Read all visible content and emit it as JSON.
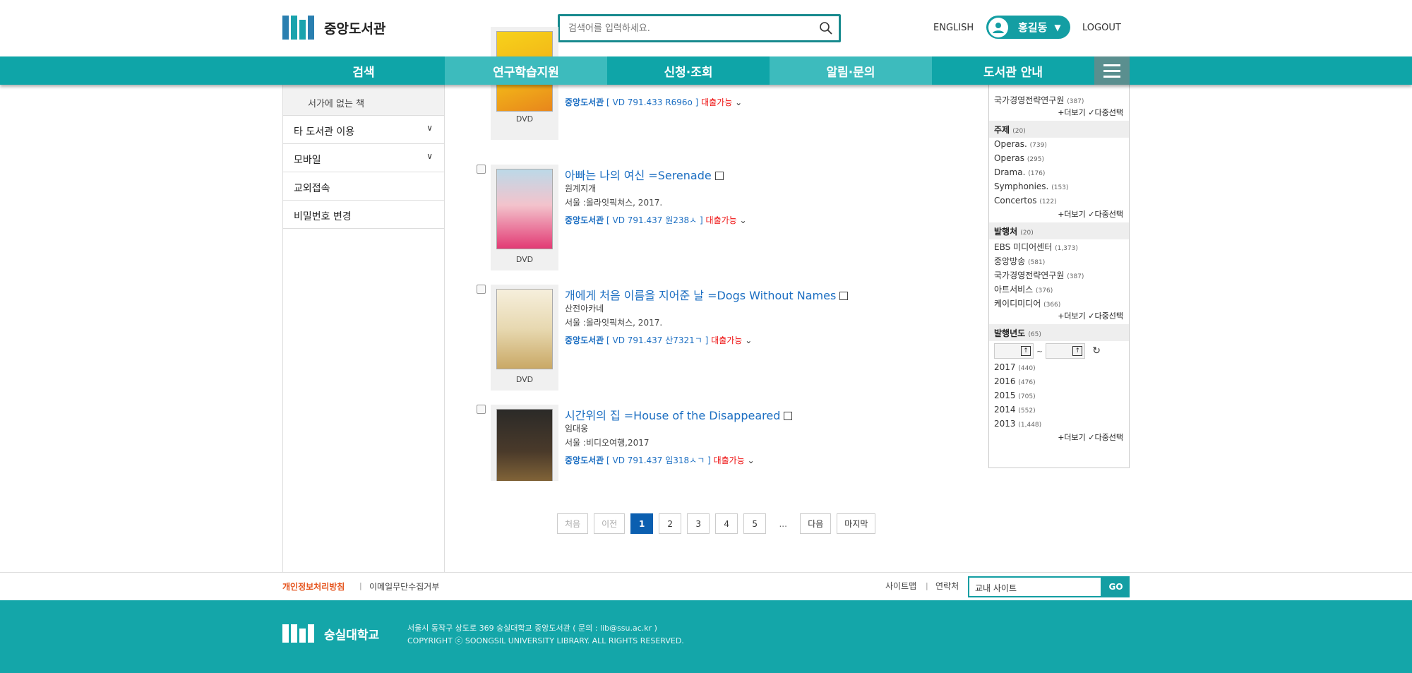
{
  "header": {
    "logo_text": "중앙도서관",
    "search_placeholder": "검색어를 입력하세요.",
    "lang_link": "ENGLISH",
    "user_name": "홍길동",
    "logout": "LOGOUT"
  },
  "nav": {
    "items": [
      {
        "label": "검색"
      },
      {
        "label": "연구학습지원"
      },
      {
        "label": "신청·조회"
      },
      {
        "label": "알림·문의"
      },
      {
        "label": "도서관 안내"
      }
    ]
  },
  "sidebar": {
    "sub_item": "서가에 없는 책",
    "items": [
      {
        "label": "타 도서관 이용"
      },
      {
        "label": "모바일"
      },
      {
        "label": "교외접속"
      },
      {
        "label": "비밀번호 변경"
      }
    ]
  },
  "results": [
    {
      "format": "DVD",
      "library": "중앙도서관",
      "call": "[ VD 791.433 R696o ]",
      "status": "대출가능"
    },
    {
      "title": "아빠는 나의 여신 =Serenade",
      "author": "원계지개",
      "publisher": "서울 :올라잇픽쳐스, 2017.",
      "format": "DVD",
      "library": "중앙도서관",
      "call": "[ VD 791.437 원238ㅅ ]",
      "status": "대출가능"
    },
    {
      "title": "개에게 처음 이름을 지어준 날 =Dogs Without Names",
      "author": "산전아카네",
      "publisher": "서울 :올라잇픽쳐스, 2017.",
      "format": "DVD",
      "library": "중앙도서관",
      "call": "[ VD 791.437 산7321ㄱ ]",
      "status": "대출가능"
    },
    {
      "title": "시간위의 집 =House of the Disappeared",
      "author": "임대웅",
      "publisher": "서울 :비디오여행,2017",
      "library": "중앙도서관",
      "call": "[ VD 791.437 임318ㅅㄱ ]",
      "status": "대출가능"
    }
  ],
  "facets": {
    "top_items": [
      {
        "label": "국가경영전략연구원",
        "count": "(387)"
      }
    ],
    "more_label": "더보기",
    "multi_label": "다중선택",
    "subject": {
      "title": "주제",
      "count": "(20)",
      "items": [
        {
          "label": "Operas.",
          "count": "(739)"
        },
        {
          "label": "Operas",
          "count": "(295)"
        },
        {
          "label": "Drama.",
          "count": "(176)"
        },
        {
          "label": "Symphonies.",
          "count": "(153)"
        },
        {
          "label": "Concertos",
          "count": "(122)"
        }
      ]
    },
    "publisher": {
      "title": "발행처",
      "count": "(20)",
      "items": [
        {
          "label": "EBS 미디어센터",
          "count": "(1,373)"
        },
        {
          "label": "중앙방송",
          "count": "(581)"
        },
        {
          "label": "국가경영전략연구원",
          "count": "(387)"
        },
        {
          "label": "아트서비스",
          "count": "(376)"
        },
        {
          "label": "케이디미디어",
          "count": "(366)"
        }
      ]
    },
    "year": {
      "title": "발행년도",
      "count": "(65)",
      "tilde": "~",
      "items": [
        {
          "label": "2017",
          "count": "(440)"
        },
        {
          "label": "2016",
          "count": "(476)"
        },
        {
          "label": "2015",
          "count": "(705)"
        },
        {
          "label": "2014",
          "count": "(552)"
        },
        {
          "label": "2013",
          "count": "(1,448)"
        }
      ]
    }
  },
  "pager": {
    "first": "처음",
    "prev": "이전",
    "pages": [
      "1",
      "2",
      "3",
      "4",
      "5"
    ],
    "dots": "...",
    "next": "다음",
    "last": "마지막",
    "current": "1"
  },
  "footer": {
    "privacy": "개인정보처리방침",
    "no_email": "이메일무단수집거부",
    "sitemap": "사이트맵",
    "contact": "연락처",
    "site_select": "교내 사이트",
    "go": "GO",
    "university": "숭실대학교",
    "address": "서울시 동작구 상도로 369 숭실대학교 중앙도서관 ( 문의 : lib@ssu.ac.kr )",
    "copyright": "COPYRIGHT ⓒ SOONGSIL UNIVERSITY LIBRARY. ALL RIGHTS RESERVED."
  },
  "colors": {
    "accent": "#0fa5a8",
    "link": "#1b6ec2",
    "available": "#ee1111",
    "current_page": "#0b5fb0"
  }
}
